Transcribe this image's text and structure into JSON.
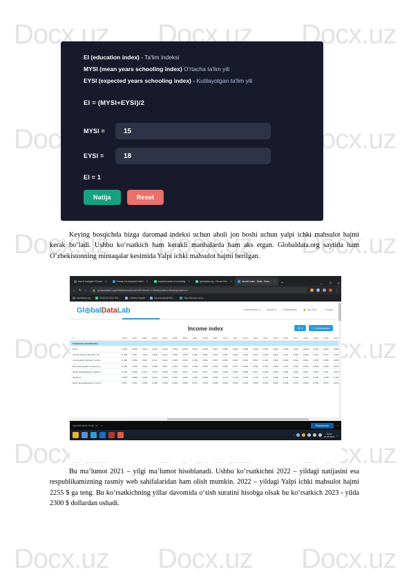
{
  "watermark": {
    "text": "Docx.uz"
  },
  "calculator": {
    "legend": [
      {
        "term": "EI (education index)",
        "sep": " - ",
        "uz": "Ta'lim indeksi"
      },
      {
        "term": "MYSI (mean years schooling index)",
        "sep": "  ",
        "uz": "O'rtacha ta'lim yili"
      },
      {
        "term": "EYSI (expected years schooling index)",
        "sep": " - ",
        "uz": "Kutilayotgan ta'lim yili"
      }
    ],
    "formula": "EI = (MYSI+EYSI)/2",
    "fields": [
      {
        "label": "MYSI =",
        "value": "15",
        "placeholder": ""
      },
      {
        "label": "EYSI =",
        "value": "18",
        "placeholder": ""
      }
    ],
    "result": "EI = 1",
    "buttons": {
      "submit": "Natija",
      "reset": "Reset"
    },
    "colors": {
      "card": "#181a2c",
      "input": "#2f3347",
      "submit": "#17a181",
      "reset": "#e8716b"
    }
  },
  "paragraphs": {
    "first": "Keying bosqichda bizga daromad indeksi uchun aholi jon boshi uchun yalpi ichki mahsulot hajmi kerak bo‘ladi. Ushbu ko‘rsatkich ham kerakli manbalarda ham aks etgan. Globaldata.org saytida ham O‘zbekistonning mintaqalar kesimida Yalpi ichki mahsulot hajmi berilgan.",
    "second": "Bu ma’lumot 2021 – yilgi ma’lumot hisoblanadi. Ushbu ko‘rsatkichni 2022 – yildagi natijasini esa respublikamizning rasmiy web sahifalaridan ham olish mumkin.  2022 – yildagi Yalpi ichki mahsulot hajmi 2255 $ ga teng. Bu ko‘rsatkichning yillar davomida o‘sish suratini hisobga olsak bu ko‘rsatkich 2023 - yilda 2300 $ dollardan oshadi."
  },
  "browser": {
    "tabs": [
      {
        "label": "how to navigate GI index",
        "favicon": "#5f6368",
        "active": false
      },
      {
        "label": "Human Development Index",
        "favicon": "#2e9bd6",
        "active": false
      },
      {
        "label": "expected years of schooling",
        "favicon": "#3ddc84",
        "active": false
      },
      {
        "label": "globaldata.org - Human Dev",
        "favicon": "#3ddc84",
        "active": false
      },
      {
        "label": "Income index - Table - Subn...",
        "favicon": "#2e9bd6",
        "active": true
      }
    ],
    "new_tab": "+",
    "window_controls": [
      "—",
      "❐",
      "✕"
    ],
    "nav": {
      "back": "←",
      "forward": "→",
      "reload": "↻",
      "home": "⌂"
    },
    "omnibox": {
      "lock": "🔒",
      "url": "globaldatalab.org/shdi/table/msschool/UZB/?levels=1+4&interpolation=0&extrapolation=0",
      "value": ""
    },
    "omni_icons": [
      "#e9a13b",
      "#8ab4f8",
      "#9aa0a6",
      "#9aa0a6"
    ],
    "bookmarks": [
      {
        "label": "worldbank.org",
        "color": "#5f6368"
      },
      {
        "label": "DATA UZ 2021 ISO...",
        "color": "#3ddc84"
      },
      {
        "label": "e-School dapteri",
        "color": "#8ab4f8"
      },
      {
        "label": "My learning MOOC...",
        "color": "#8ab4f8"
      },
      {
        "label": "Data Science va Su...",
        "color": "#2e9bd6"
      }
    ]
  },
  "site": {
    "logo": {
      "gl": "Gl",
      "obal": "bal",
      "data": "Data",
      "lab": "Lab"
    },
    "nav": [
      {
        "label": "Instruments",
        "caret": "∨"
      },
      {
        "label": "About",
        "caret": "∨"
      },
      {
        "label": "Publications",
        "caret": ""
      },
      {
        "label": "My GDL",
        "icon": "lock"
      },
      {
        "label": "Home",
        "icon": "home"
      }
    ],
    "panel_title": "Income index",
    "actions": [
      {
        "label": "",
        "icon": "gear"
      },
      {
        "label": "Go full screen",
        "icon": "expand"
      }
    ],
    "accent": "#2e9bd6"
  },
  "table": {
    "corner": "✕",
    "years": [
      "2000",
      "2001",
      "2002",
      "2003",
      "2004",
      "2005",
      "2006",
      "2007",
      "2008",
      "2009",
      "2010",
      "2011",
      "2012",
      "2013",
      "2014",
      "2015",
      "2016",
      "2017",
      "2018",
      "2019",
      "2020",
      "2021"
    ],
    "group_label": "Uzbekistan (Asia/Pacific)",
    "rows": [
      {
        "label": "Total",
        "values": [
          "0.500",
          "0.508",
          "0.511",
          "0.516",
          "0.528",
          "0.534",
          "0.540",
          "0.551",
          "0.566",
          "0.575",
          "0.585",
          "0.599",
          "0.608",
          "0.618",
          "0.625",
          "0.650",
          "0.655",
          "0.641",
          "0.648",
          "0.653",
          "0.662",
          "0.660"
        ]
      },
      {
        "label": "Central (Navoi, Bukhara, Sa...",
        "values": [
          "0.400",
          "0.497",
          "0.503",
          "0.508",
          "0.519",
          "0.529",
          "0.535",
          "0.552",
          "0.561",
          "0.570",
          "0.584",
          "0.594",
          "0.603",
          "0.613",
          "0.620",
          "0.625",
          "0.621",
          "0.635",
          "0.643",
          "0.647",
          "0.647",
          "0.626"
        ]
      },
      {
        "label": "Central-East (Djizzak, Syrdar...",
        "values": [
          "0.499",
          "0.506",
          "0.511",
          "0.517",
          "0.522",
          "0.526",
          "0.543",
          "0.554",
          "0.569",
          "0.578",
          "0.582",
          "0.602",
          "0.611",
          "0.621",
          "0.624",
          "0.628",
          "0.639",
          "0.644",
          "0.651",
          "0.655",
          "0.635",
          "0.661"
        ]
      },
      {
        "label": "East (Namangan, Fergana, A...",
        "values": [
          "0.484",
          "0.489",
          "0.493",
          "0.498",
          "0.507",
          "0.515",
          "0.519",
          "0.540",
          "0.545",
          "0.554",
          "0.598",
          "0.577",
          "0.586",
          "0.598",
          "0.603",
          "0.608",
          "0.613",
          "0.619",
          "0.626",
          "0.630",
          "0.630",
          "0.638"
        ]
      },
      {
        "label": "South (Kashkadarya, Surkha...",
        "values": [
          "0.462",
          "0.468",
          "0.473",
          "0.478",
          "0.488",
          "0.496",
          "0.502",
          "0.522",
          "0.527",
          "0.556",
          "0.548",
          "0.569",
          "0.558",
          "0.577",
          "0.584",
          "0.589",
          "0.654",
          "0.602",
          "0.607",
          "0.610",
          "0.611",
          "0.618"
        ]
      },
      {
        "label": "Tashkent",
        "values": [
          "0.525",
          "0.588",
          "0.604",
          "0.617",
          "0.630",
          "0.646",
          "0.659",
          "0.682",
          "0.698",
          "0.696",
          "0.713",
          "0.724",
          "0.750",
          "0.745",
          "0.767",
          "0.798",
          "0.784",
          "0.723",
          "0.728",
          "0.782",
          "0.788",
          "0.790"
        ]
      },
      {
        "label": "West (Qoraqalpoqston, Khore...",
        "values": [
          "0.517",
          "0.522",
          "0.525",
          "0.529",
          "0.538",
          "0.545",
          "0.550",
          "0.571",
          "0.576",
          "0.585",
          "0.600",
          "0.609",
          "0.619",
          "0.628",
          "0.635",
          "0.661",
          "0.646",
          "0.672",
          "0.659",
          "0.660",
          "0.667",
          "0.671"
        ]
      }
    ]
  },
  "os": {
    "download_label": "expected years of sch...cx",
    "download_caret": "∧",
    "show_all": "Показать все",
    "close": "✕",
    "taskbar_icons": [
      "#e8b339",
      "#5a8fd6",
      "#2e9bd6",
      "#1f6fb8",
      "#b03a2e",
      "#e35d3c"
    ],
    "tray_icons": [
      "#8ab4f8",
      "#e8b339",
      "#c9ccd0",
      "#c9ccd0",
      "#c9ccd0"
    ],
    "clock_time": "16:54",
    "clock_date": "23.05.2023",
    "notification": "▢"
  }
}
